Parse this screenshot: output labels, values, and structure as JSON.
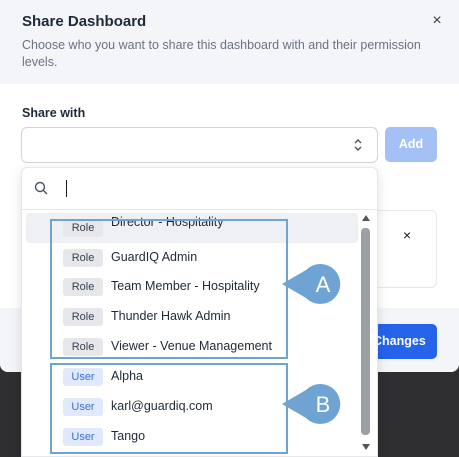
{
  "modal": {
    "title": "Share Dashboard",
    "subtitle": "Choose who you want to share this dashboard with and their permission levels.",
    "close_glyph": "×",
    "share_label": "Share with",
    "add_label": "Add",
    "save_label": "Changes",
    "card_remove_glyph": "×"
  },
  "dropdown": {
    "search_value": "",
    "options": [
      {
        "tag": "Role",
        "label": "Director - Hospitality"
      },
      {
        "tag": "Role",
        "label": "GuardIQ Admin"
      },
      {
        "tag": "Role",
        "label": "Team Member - Hospitality"
      },
      {
        "tag": "Role",
        "label": "Thunder Hawk Admin"
      },
      {
        "tag": "Role",
        "label": "Viewer - Venue Management"
      },
      {
        "tag": "User",
        "label": "Alpha"
      },
      {
        "tag": "User",
        "label": "karl@guardiq.com"
      },
      {
        "tag": "User",
        "label": "Tango"
      }
    ]
  },
  "annotations": {
    "callout_a": "A",
    "callout_b": "B",
    "color": "#6fa3d3"
  },
  "colors": {
    "primary": "#2563eb",
    "primary_disabled": "#a5c0f5",
    "role_tag": "#e5e7eb",
    "user_tag": "#e0e9fb"
  }
}
